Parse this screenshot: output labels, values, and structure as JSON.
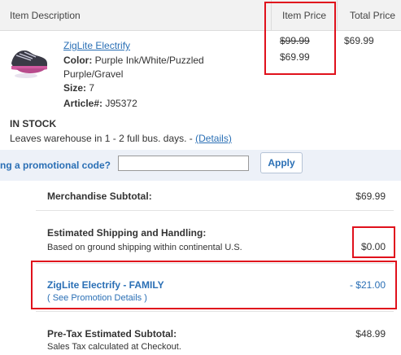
{
  "header": {
    "item_description": "Item Description",
    "item_price": "Item Price",
    "total_price": "Total Price"
  },
  "product": {
    "name": "ZigLite Electrify",
    "color_label": "Color:",
    "color_value_line1": "Purple Ink/White/Puzzled",
    "color_value_line2": "Purple/Gravel",
    "size_label": "Size:",
    "size_value": "7",
    "article_label": "Article#:",
    "article_value": "J95372",
    "original_price": "$99.99",
    "sale_price": "$69.99",
    "total_price": "$69.99",
    "stock_status": "IN STOCK",
    "shipping_note": "Leaves warehouse in 1 - 2 full bus. days. -",
    "details_link": "(Details)"
  },
  "promo": {
    "label": "ng a promotional code?",
    "input_value": "",
    "apply_label": "Apply"
  },
  "summary": {
    "merch_label": "Merchandise Subtotal:",
    "merch_value": "$69.99",
    "ship_label": "Estimated Shipping and Handling:",
    "ship_note": "Based on ground shipping within continental U.S.",
    "ship_value": "$0.00",
    "promo_name": "ZigLite Electrify - FAMILY",
    "promo_details": "( See Promotion Details )",
    "promo_value": "- $21.00",
    "pretax_label": "Pre-Tax Estimated Subtotal:",
    "pretax_value": "$48.99",
    "tax_note": "Sales Tax calculated at Checkout."
  },
  "colors": {
    "highlight": "#e0111c",
    "link": "#2a6fb5",
    "promo_band": "#edf1f8"
  }
}
